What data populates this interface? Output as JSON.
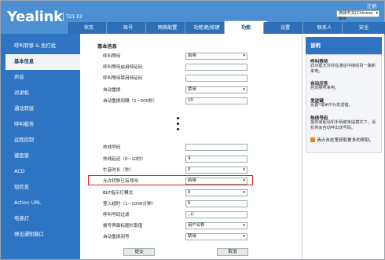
{
  "header": {
    "logo": "Yealink",
    "model": "T21 E2",
    "logout": "注销",
    "language": "简体中文(Chinese Sim"
  },
  "tabs": [
    "状态",
    "账号",
    "网络配置",
    "功能键/按键",
    "功能",
    "设置",
    "联系人",
    "安全"
  ],
  "active_tab": "功能",
  "sidebar": {
    "items": [
      "呼叫转移 & 免打扰",
      "基本信息",
      "声音",
      "对讲机",
      "通话转接",
      "呼叫截答",
      "远程控制",
      "键盘锁",
      "ACD",
      "短信息",
      "Action URL",
      "电源灯",
      "弹出通知窗口"
    ],
    "active": "基本信息"
  },
  "main": {
    "section_title": "基本信息",
    "rows": [
      {
        "label": "呼叫等待",
        "value": "启用",
        "type": "select"
      },
      {
        "label": "呼叫等待启用特征码",
        "value": "",
        "type": "text"
      },
      {
        "label": "呼叫等待禁用特征码",
        "value": "",
        "type": "text"
      },
      {
        "label": "自动重拨",
        "value": "禁用",
        "type": "select"
      },
      {
        "label": "自动重拨间隔（1~300秒）",
        "value": "10",
        "type": "text"
      },
      {
        "label": "热线号码",
        "value": "",
        "type": "text"
      },
      {
        "label": "热线延迟（0~10秒）",
        "value": "4",
        "type": "text"
      },
      {
        "label": "忙音时长（秒）",
        "value": "0",
        "type": "select"
      },
      {
        "label": "允许转移已有呼叫",
        "value": "启用",
        "type": "select"
      },
      {
        "label": "BLF指示灯模式",
        "value": "0",
        "type": "select"
      },
      {
        "label": "登入超时（1~1000分钟）",
        "value": "5",
        "type": "text"
      },
      {
        "label": "呼叫号码过滤",
        "value": ",-()",
        "type": "text"
      },
      {
        "label": "拨号界面标题栏取值",
        "value": "用户名称",
        "type": "select"
      },
      {
        "label": "自动重拨间号",
        "value": "禁用",
        "type": "select"
      }
    ],
    "submit_label": "提交",
    "cancel_label": "取消"
  },
  "help": {
    "title": "说明",
    "entries": [
      {
        "title": "呼叫等待",
        "text": "此功能允许你在通话中接收另一路新来电。"
      },
      {
        "title": "自动应答",
        "text": "自动接听来电。"
      },
      {
        "title": "发送键",
        "text": "设置*或#作为发送键。"
      },
      {
        "title": "热线号码",
        "text": "指你拿起话机手柄或免提模式下，话机将会自动呼出该号码。"
      }
    ],
    "more_link": "请点击这里获取更多的帮助。"
  }
}
